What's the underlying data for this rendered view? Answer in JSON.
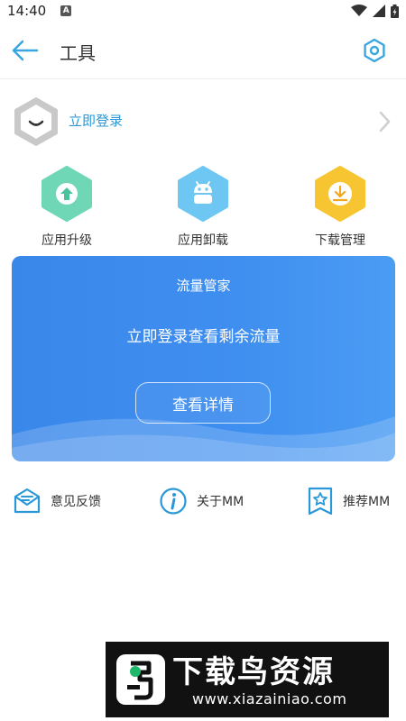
{
  "status_bar": {
    "time": "14:40",
    "notification_badge": "A"
  },
  "header": {
    "title": "工具"
  },
  "login": {
    "label": "立即登录"
  },
  "tools": [
    {
      "label": "应用升级",
      "icon": "upload-arrow-icon",
      "color": "#6fd6b6"
    },
    {
      "label": "应用卸载",
      "icon": "android-icon",
      "color": "#6ec7f3"
    },
    {
      "label": "下载管理",
      "icon": "download-icon",
      "color": "#f7c531"
    }
  ],
  "traffic_card": {
    "title": "流量管家",
    "subtitle": "立即登录查看剩余流量",
    "button": "查看详情"
  },
  "links": [
    {
      "label": "意见反馈",
      "icon": "feedback-mail-icon"
    },
    {
      "label": "关于MM",
      "icon": "info-icon"
    },
    {
      "label": "推荐MM",
      "icon": "star-badge-icon"
    }
  ],
  "watermark": {
    "name": "下载鸟资源",
    "url": "www.xiazainiao.com"
  },
  "colors": {
    "accent": "#2a98d8",
    "card": "#3f8ff0"
  }
}
